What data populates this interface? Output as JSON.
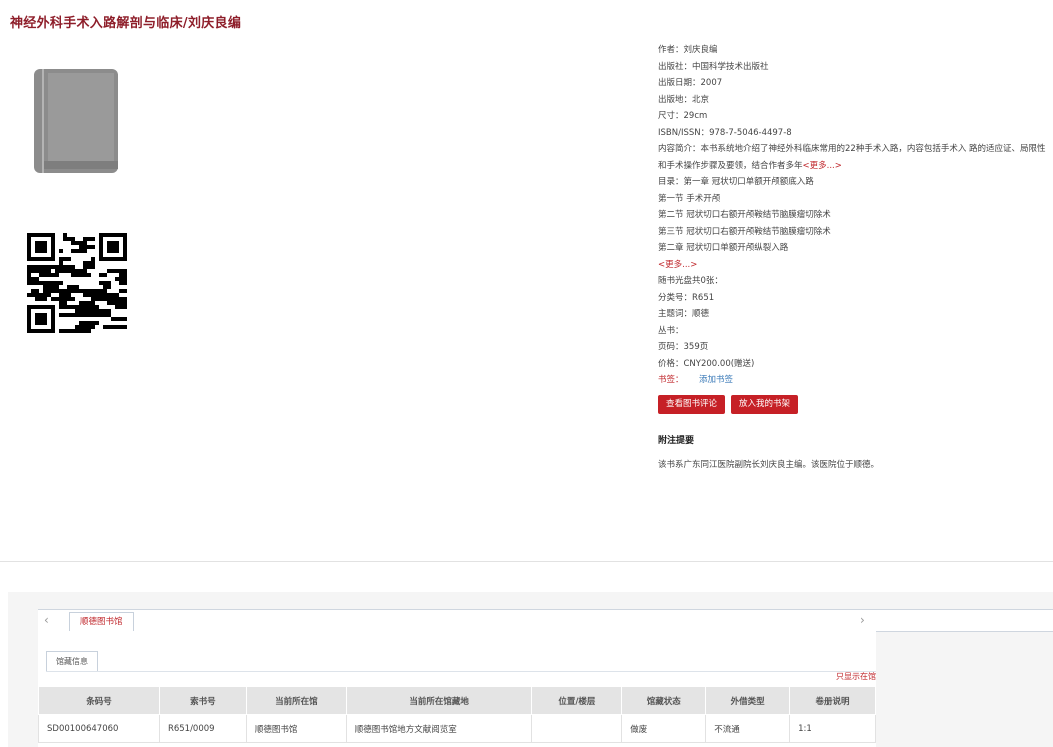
{
  "page_title": "神经外科手术入路解剖与临床/刘庆良编",
  "book_info": {
    "author": "作者：刘庆良编",
    "publisher": "出版社：中国科学技术出版社",
    "pub_date": "出版日期：2007",
    "pub_place": "出版地：北京",
    "size": "尺寸：29cm",
    "isbn": "ISBN/ISSN：978-7-5046-4497-8",
    "summary": "内容简介：本书系统地介绍了神经外科临床常用的22种手术入路，内容包括手术入 路的适应证、局限性和手术操作步骤及要领，结合作者多年",
    "summary_more": "<更多...>",
    "toc_first": "目录：第一章 冠状切口单额开颅额底入路",
    "toc_lines": [
      "第一节 手术开颅",
      "第二节 冠状切口右额开颅鞍结节脑膜瘤切除术",
      "第三节 冠状切口右额开颅鞍结节脑膜瘤切除术",
      "第二章 冠状切口单额开颅纵裂入路"
    ],
    "toc_more": "<更多...>",
    "cd_count": "随书光盘共0张：",
    "class_no": "分类号：R651",
    "subject": "主题词：顺德",
    "series": "丛书：",
    "pages": "页码：359页",
    "price": "价格：CNY200.00(赠送)",
    "tag_label": "书签：",
    "tag_link": "添加书签",
    "btn_review": "查看图书评论",
    "btn_shelf": "放入我的书架",
    "notes_title": "附注提要",
    "notes_text": "该书系广东同江医院副院长刘庆良主编。该医院位于顺德。"
  },
  "holdings": {
    "arrow_left": "‹",
    "arrow_right": "›",
    "library_tab": "顺德图书馆",
    "sub_tab": "馆藏信息",
    "only_current": "只显示在馆",
    "columns": [
      "条码号",
      "索书号",
      "当前所在馆",
      "当前所在馆藏地",
      "位置/楼层",
      "馆藏状态",
      "外借类型",
      "卷册说明"
    ],
    "rows": [
      [
        "SD00100647060",
        "R651/0009",
        "顺德图书馆",
        "顺德图书馆地方文献阅览室",
        "",
        "做废",
        "不流通",
        "1:1"
      ]
    ]
  },
  "icons": {
    "book": "book-icon",
    "qr": "qr-code"
  },
  "colors": {
    "title": "#8e1e2a",
    "button_bg": "#c62026",
    "link_red": "#c0282d",
    "link_blue": "#3a7ab8"
  }
}
